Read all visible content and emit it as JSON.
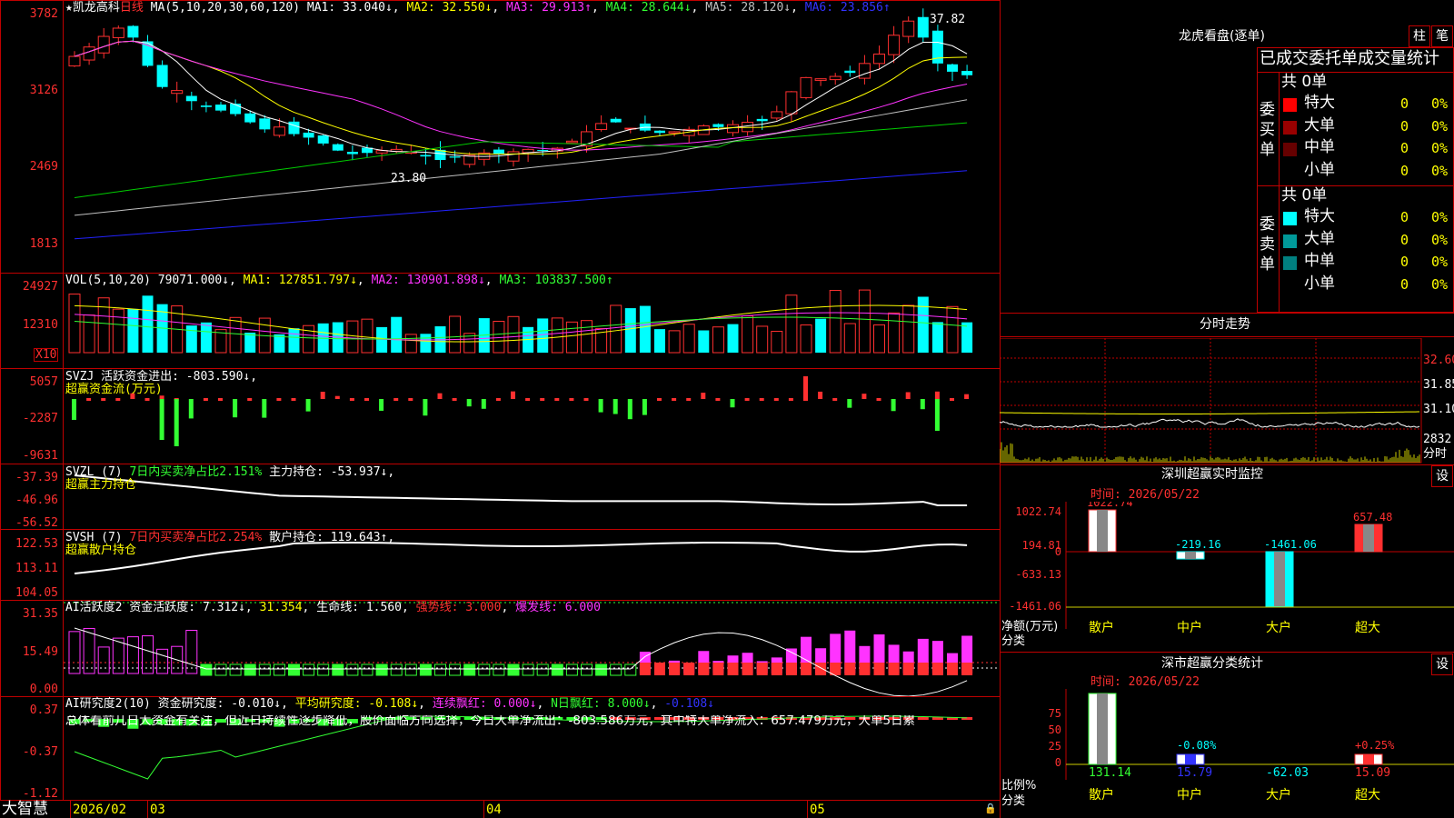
{
  "main_chart": {
    "header": {
      "star_name": "★凯龙高科",
      "period": "日线",
      "ma_params": "MA(5,10,20,30,60,120)",
      "ma1": "MA1: 33.040↓",
      "ma2": "MA2: 32.550↓",
      "ma3": "MA3: 29.913↑",
      "ma4": "MA4: 28.644↓",
      "ma5": "MA5: 28.120↓",
      "ma6": "MA6: 23.856↑"
    },
    "y_labels": [
      "3782",
      "3126",
      "2469",
      "1813"
    ],
    "high_mark": "37.82",
    "low_mark": "23.80"
  },
  "vol_panel": {
    "header": "VOL(5,10,20) 79071.000↓",
    "ma1": "MA1: 127851.797↓",
    "ma2": "MA2: 130901.898↓",
    "ma3": "MA3: 103837.500↑",
    "y_labels": [
      "24927",
      "12310"
    ],
    "unit": "X10"
  },
  "svzj_panel": {
    "header": "SVZJ  活跃资金进出: -803.590↓,",
    "subtitle": "超赢资金流(万元)",
    "y_labels": [
      "5057",
      "-2287",
      "-9631"
    ]
  },
  "svzl_panel": {
    "header_a": "SVZL (7)",
    "header_b": "7日内买卖净占比2.151%",
    "header_c": "主力持仓: -53.937↓,",
    "subtitle": "超赢主力持仓",
    "y_labels": [
      "-37.39",
      "-46.96",
      "-56.52"
    ]
  },
  "svsh_panel": {
    "header_a": "SVSH (7)",
    "header_b": "7日内买卖净占比2.254%",
    "header_c": "散户持仓: 119.643↑,",
    "subtitle": "超赢散户持仓",
    "y_labels": [
      "122.53",
      "113.11",
      "104.05"
    ]
  },
  "ai_active_panel": {
    "header_a": "AI活跃度2 资金活跃度: 7.312↓",
    "header_b": "31.354",
    "header_c": "生命线: 1.560",
    "header_d": "强势线: 3.000",
    "header_e": "爆发线: 6.000",
    "y_labels": [
      "31.35",
      "15.49",
      "0.00"
    ]
  },
  "ai_research_panel": {
    "header_a": "AI研究度2(10) 资金研究度: -0.010↓",
    "header_b": "平均研究度: -0.108↓",
    "header_c": "连续飘红: 0.000↓",
    "header_d": "N日飘红: 8.000↓",
    "header_e": "-0.108↓",
    "summary": "总体看前几日大资金有关注，但近日持续性逐步降低，股价面临方向选择，今日大单净流出：-803.586万元，其中特大单净流入：657.479万元，大单5日累",
    "y_labels": [
      "0.37",
      "-0.37",
      "-1.12"
    ]
  },
  "x_axis": {
    "brand": "大智慧",
    "labels": [
      "2026/02",
      "03",
      "04",
      "05"
    ]
  },
  "right_panel": {
    "dragon_tiger_title": "龙虎看盘(逐单)",
    "btn_bar": "柱",
    "btn_pen": "笔",
    "table_header": "已成交委托单成交量统计",
    "buy_group_label": "委买单",
    "buy_total": "共 0单",
    "sell_group_label": "委卖单",
    "sell_total": "共 0单",
    "buy_rows": [
      {
        "name": "特大",
        "count": "0",
        "pct": "0%",
        "color": "#ff0000"
      },
      {
        "name": "大单",
        "count": "0",
        "pct": "0%",
        "color": "#990000"
      },
      {
        "name": "中单",
        "count": "0",
        "pct": "0%",
        "color": "#660000"
      },
      {
        "name": "小单",
        "count": "0",
        "pct": "0%",
        "color": "#000000"
      }
    ],
    "sell_rows": [
      {
        "name": "特大",
        "count": "0",
        "pct": "0%",
        "color": "#00ffff"
      },
      {
        "name": "大单",
        "count": "0",
        "pct": "0%",
        "color": "#009999"
      },
      {
        "name": "中单",
        "count": "0",
        "pct": "0%",
        "color": "#008080"
      },
      {
        "name": "小单",
        "count": "0",
        "pct": "0%",
        "color": "#000000"
      }
    ],
    "intraday_title": "分时走势",
    "intraday_labels": [
      "32.60",
      "31.85",
      "31.10"
    ],
    "intraday_vol": "2832",
    "intraday_unit": "分时",
    "sz_monitor": {
      "title": "深圳超赢实时监控",
      "settings": "设",
      "time": "时间: 2026/05/22",
      "y_labels": [
        "1022.74",
        "194.81",
        "0",
        "-633.13",
        "-1461.06"
      ],
      "unit_a": "净额(万元)",
      "unit_b": "分类",
      "categories": [
        "散户",
        "中户",
        "大户",
        "超大"
      ],
      "values": [
        "1022.74",
        "-219.16",
        "-1461.06",
        "657.48"
      ]
    },
    "sz_classify": {
      "title": "深市超赢分类统计",
      "settings": "设",
      "time": "时间: 2026/05/22",
      "y_labels": [
        "75",
        "50",
        "25",
        "0"
      ],
      "unit_a": "比例%",
      "unit_b": "分类",
      "categories": [
        "散户",
        "中户",
        "大户",
        "超大"
      ],
      "bottom_values": [
        "131.14",
        "15.79",
        "-62.03",
        "15.09"
      ],
      "top_values": [
        "",
        "-0.08%",
        "",
        "+0.25%"
      ]
    }
  }
}
